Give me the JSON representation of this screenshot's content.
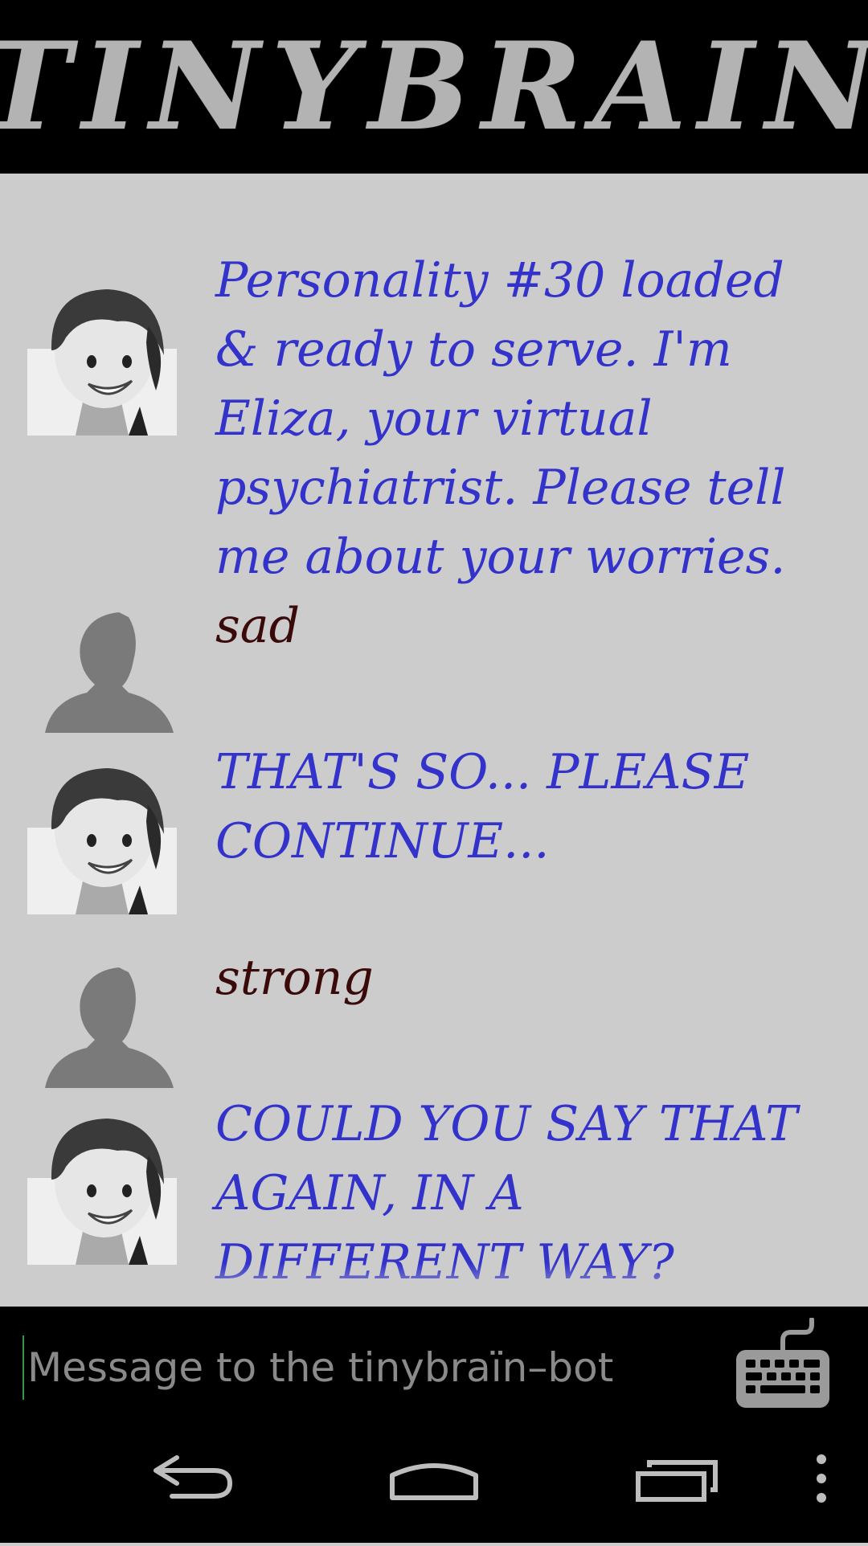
{
  "header": {
    "logo_text": "TINYBRAIN"
  },
  "messages": [
    {
      "sender": "bot",
      "avatar_icon": "eliza-avatar-icon",
      "text": "Personality #30 loaded & ready to serve. I'm Eliza, your virtual psychiatrist. Please tell me about your worries."
    },
    {
      "sender": "user",
      "avatar_icon": "user-silhouette-icon",
      "text": "sad"
    },
    {
      "sender": "bot",
      "avatar_icon": "eliza-avatar-icon",
      "text": "THAT'S SO... PLEASE CONTINUE..."
    },
    {
      "sender": "user",
      "avatar_icon": "user-silhouette-icon",
      "text": "strong"
    },
    {
      "sender": "bot",
      "avatar_icon": "eliza-avatar-icon",
      "text": "COULD YOU SAY THAT AGAIN, IN A DIFFERENT WAY?"
    }
  ],
  "composer": {
    "placeholder": "Message to the tinybraïn–bot",
    "value": "",
    "keyboard_icon": "keyboard-icon"
  },
  "navbar": {
    "back_icon": "back-icon",
    "home_icon": "home-icon",
    "recents_icon": "recent-apps-icon",
    "menu_icon": "overflow-menu-icon"
  },
  "colors": {
    "header_bg": "#000000",
    "logo": "#b3b3b3",
    "chat_bg": "#cccccc",
    "bot_text": "#3333cc",
    "user_text": "#3a0a0a",
    "cursor": "#2d9a4d"
  }
}
